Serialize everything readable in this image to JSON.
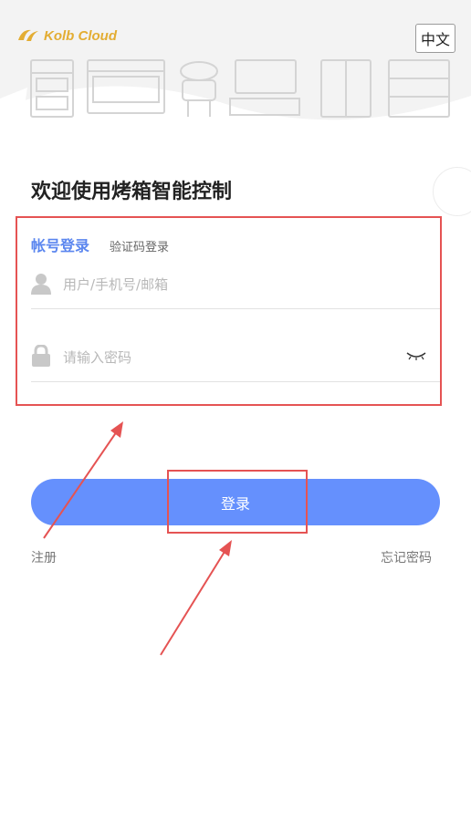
{
  "header": {
    "logo_text": "Kolb Cloud",
    "lang_button": "中文"
  },
  "welcome": "欢迎使用烤箱智能控制",
  "tabs": {
    "account": "帐号登录",
    "code": "验证码登录"
  },
  "fields": {
    "user_placeholder": "用户/手机号/邮箱",
    "password_placeholder": "请输入密码"
  },
  "login_button": "登录",
  "links": {
    "register": "注册",
    "forgot": "忘记密码"
  },
  "colors": {
    "accent": "#6590fd",
    "tab_active": "#5b86ef",
    "annotation": "#e55353",
    "logo": "#e3ad33"
  }
}
